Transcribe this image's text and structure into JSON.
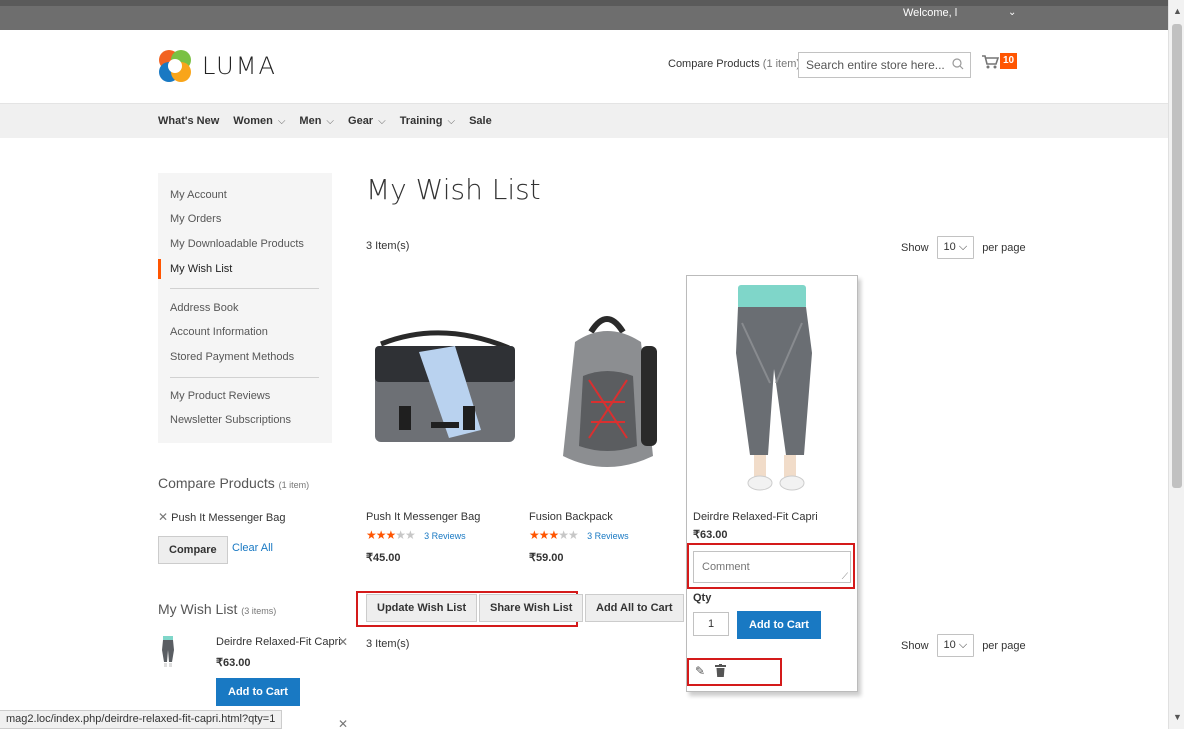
{
  "header": {
    "welcome": "Welcome, l",
    "logo_text": "LUMA",
    "compare_label": "Compare Products",
    "compare_count": "(1 item)",
    "search_placeholder": "Search entire store here...",
    "cart_count": "10"
  },
  "nav": {
    "items": [
      {
        "label": "What's New"
      },
      {
        "label": "Women"
      },
      {
        "label": "Men"
      },
      {
        "label": "Gear"
      },
      {
        "label": "Training"
      },
      {
        "label": "Sale"
      }
    ]
  },
  "sidebar": {
    "items": [
      "My Account",
      "My Orders",
      "My Downloadable Products",
      "My Wish List",
      "Address Book",
      "Account Information",
      "Stored Payment Methods",
      "My Product Reviews",
      "Newsletter Subscriptions"
    ],
    "compare_title": "Compare Products",
    "compare_count": "(1 item)",
    "compare_item": "Push It Messenger Bag",
    "compare_button": "Compare",
    "clear_all": "Clear All",
    "wishlist_title": "My Wish List",
    "wishlist_count": "(3 items)",
    "wishlist_item_name": "Deirdre Relaxed-Fit Capri",
    "wishlist_item_price": "₹63.00",
    "add_to_cart": "Add to Cart"
  },
  "main": {
    "title": "My Wish List",
    "item_count": "3 Item(s)",
    "show_label": "Show",
    "per_page_value": "10",
    "per_page_label": "per page",
    "products": [
      {
        "name": "Push It Messenger Bag",
        "price": "₹45.00",
        "reviews": "3 Reviews",
        "rating": 3.5
      },
      {
        "name": "Fusion Backpack",
        "price": "₹59.00",
        "reviews": "3 Reviews",
        "rating": 3.5
      },
      {
        "name": "Deirdre Relaxed-Fit Capri",
        "price": "₹63.00"
      }
    ],
    "comment_placeholder": "Comment",
    "qty_label": "Qty",
    "qty_value": "1",
    "add_to_cart": "Add to Cart",
    "update_button": "Update Wish List",
    "share_button": "Share Wish List",
    "add_all_button": "Add All to Cart"
  },
  "status_url": "mag2.loc/index.php/deirdre-relaxed-fit-capri.html?qty=1",
  "colors": {
    "accent": "#1979c3",
    "brand_orange": "#ff5501",
    "highlight_red": "#d41a1a"
  }
}
